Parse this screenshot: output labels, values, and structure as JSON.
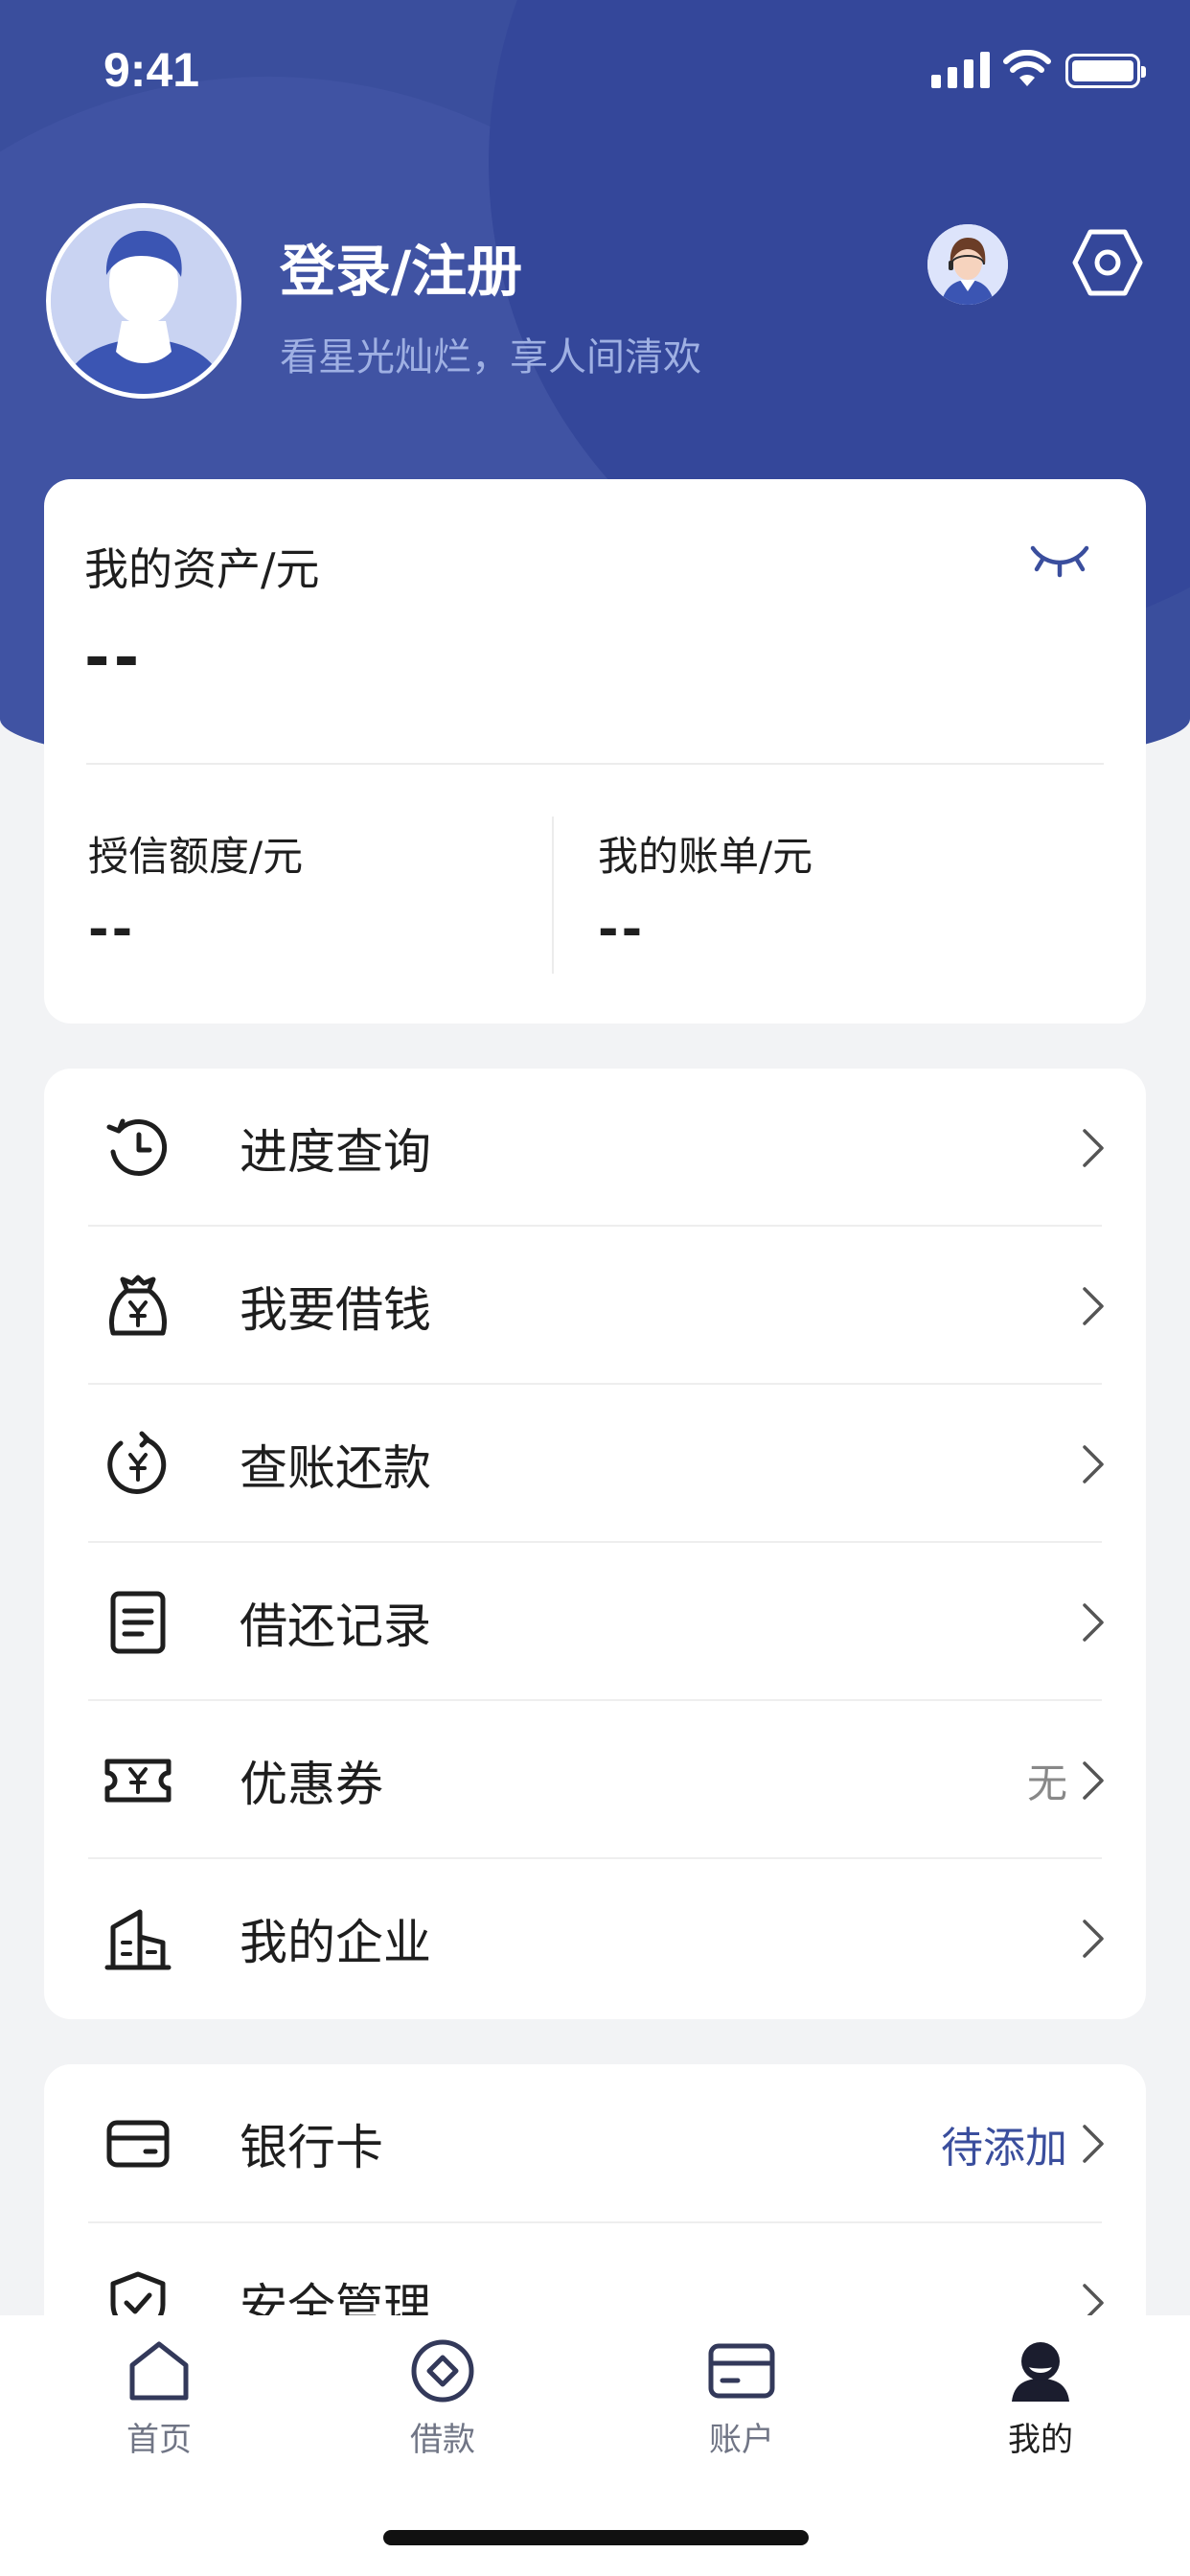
{
  "status_bar": {
    "time": "9:41"
  },
  "profile": {
    "login_label": "登录/注册",
    "slogan": "看星光灿烂，享人间清欢",
    "service_icon": "customer-service-icon",
    "settings_icon": "settings-icon"
  },
  "assets": {
    "title": "我的资产/元",
    "value": "--",
    "credit_title": "授信额度/元",
    "credit_value": "--",
    "bill_title": "我的账单/元",
    "bill_value": "--",
    "eye_icon": "eye-closed-icon"
  },
  "menu": [
    {
      "label": "进度查询",
      "icon": "progress-clock-icon",
      "value": ""
    },
    {
      "label": "我要借钱",
      "icon": "money-bag-icon",
      "value": ""
    },
    {
      "label": "查账还款",
      "icon": "repay-refresh-icon",
      "value": ""
    },
    {
      "label": "借还记录",
      "icon": "record-list-icon",
      "value": ""
    },
    {
      "label": "优惠券",
      "icon": "coupon-icon",
      "value": "无"
    },
    {
      "label": "我的企业",
      "icon": "building-icon",
      "value": ""
    }
  ],
  "menu2": [
    {
      "label": "银行卡",
      "icon": "bank-card-icon",
      "value": "待添加"
    },
    {
      "label": "安全管理",
      "icon": "shield-check-icon",
      "value": ""
    }
  ],
  "tabs": [
    {
      "label": "首页",
      "icon": "home-icon"
    },
    {
      "label": "借款",
      "icon": "loan-diamond-icon"
    },
    {
      "label": "账户",
      "icon": "account-card-icon"
    },
    {
      "label": "我的",
      "icon": "profile-icon",
      "active": true
    }
  ],
  "colors": {
    "primary": "#3a4e9d",
    "background": "#f2f3f5",
    "text": "#1e1e1e"
  }
}
